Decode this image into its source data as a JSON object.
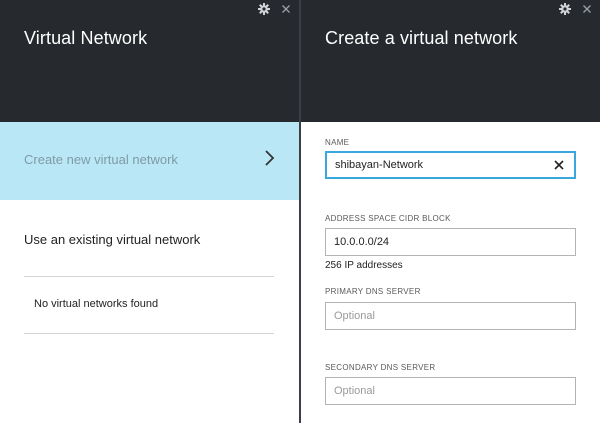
{
  "left_blade": {
    "title": "Virtual Network",
    "create_item_label": "Create new virtual network",
    "existing_heading": "Use an existing virtual network",
    "empty_message": "No virtual networks found"
  },
  "right_blade": {
    "title": "Create a virtual network",
    "fields": {
      "name": {
        "label": "NAME",
        "value": "shibayan-Network"
      },
      "address_space": {
        "label": "ADDRESS SPACE CIDR BLOCK",
        "value": "10.0.0.0/24",
        "helper": "256 IP addresses"
      },
      "primary_dns": {
        "label": "PRIMARY DNS SERVER",
        "value": "",
        "placeholder": "Optional"
      },
      "secondary_dns": {
        "label": "SECONDARY DNS SERVER",
        "value": "",
        "placeholder": "Optional"
      }
    }
  },
  "icons": {
    "settings": "gear-icon",
    "close": "close-icon",
    "navigate": "chevron-right-icon",
    "clear": "clear-x-icon"
  },
  "colors": {
    "header_bg": "#262a2f",
    "selected_item_bg": "#b9e7f6",
    "focus_border": "#3aa8de",
    "divider": "#3a4046"
  }
}
